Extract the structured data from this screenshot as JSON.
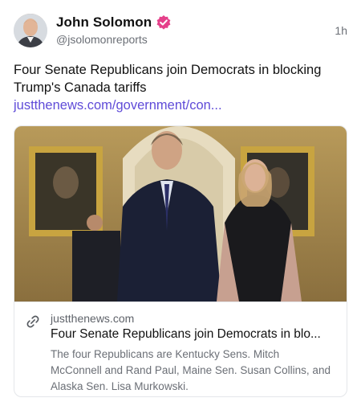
{
  "author": {
    "name": "John Solomon",
    "handle": "@jsolomonreports",
    "avatar_icon": "user-avatar",
    "verified_icon": "verified-badge-icon",
    "verified_color": "#e5408a"
  },
  "post": {
    "timestamp": "1h",
    "text": "Four Senate Republicans join Democrats in blocking Trump's Canada tariffs ",
    "link_text": "justthenews.com/government/con...",
    "link_color": "#5f4bd8"
  },
  "link_card": {
    "image_icon": "article-photo",
    "link_icon": "link-icon",
    "domain": "justthenews.com",
    "title": "Four Senate Republicans join Democrats in blo...",
    "description": "The four Republicans are Kentucky Sens. Mitch McConnell and Rand Paul, Maine Sen. Susan Collins, and Alaska Sen. Lisa Murkowski."
  }
}
